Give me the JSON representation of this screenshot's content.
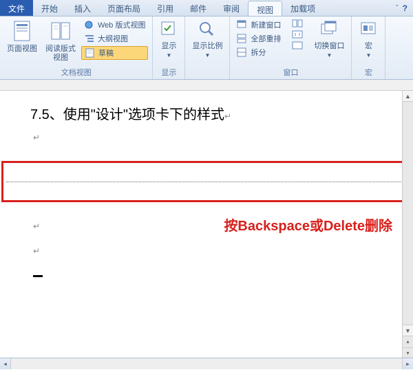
{
  "tabs": {
    "file": "文件",
    "items": [
      "开始",
      "插入",
      "页面布局",
      "引用",
      "邮件",
      "审阅",
      "视图",
      "加载项"
    ],
    "active_index": 6
  },
  "ribbon": {
    "doc_views": {
      "label": "文档视图",
      "page_view": "页面视图",
      "reading_view": "阅读版式\n视图",
      "web_view": "Web 版式视图",
      "outline_view": "大纲视图",
      "draft": "草稿"
    },
    "show": {
      "label": "显示",
      "btn": "显示"
    },
    "zoom": {
      "label": "",
      "btn": "显示比例"
    },
    "window": {
      "label": "窗口",
      "new_window": "新建窗口",
      "arrange_all": "全部重排",
      "split": "拆分",
      "switch_window": "切换窗口"
    },
    "macros": {
      "label": "宏",
      "btn": "宏"
    }
  },
  "document": {
    "heading": "7.5、使用\"设计\"选项卡下的样式",
    "annotation": "按Backspace或Delete删除",
    "para_mark": "↵"
  }
}
